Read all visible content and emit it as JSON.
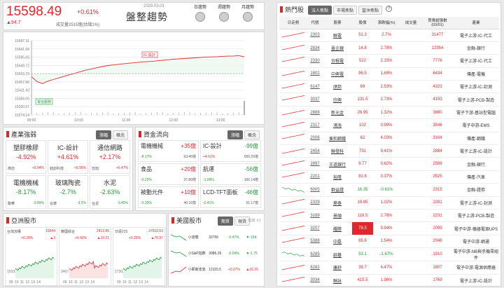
{
  "index": {
    "value": "15598.49",
    "pct": "+0.61%",
    "change": "▲94.7",
    "volume": "成交量2515億(估增1%)",
    "trend": "盤整趨勢",
    "periods": [
      "日趨勢",
      "週趨勢",
      "月趨勢"
    ],
    "date": "2029.03.01"
  },
  "intraday": {
    "yticks": [
      "15687.31",
      "15641.58",
      "15595.65",
      "15549.72",
      "15503.79",
      "15457.86",
      "15411.93",
      "15366.00",
      "15320.07",
      "15274.14"
    ],
    "xticks": [
      "09:00",
      "10:00",
      "11:00",
      "12:00",
      "13:00"
    ],
    "tag1": "IC-設計",
    "tag2": "電信服務",
    "chart_data": {
      "type": "line",
      "x_range": [
        "09:00",
        "13:30"
      ],
      "ylim": [
        15274.14,
        15687.31
      ],
      "series": [
        {
          "values": [
            15487,
            15460,
            15448,
            15462,
            15471,
            15480,
            15489,
            15498,
            15506,
            15515,
            15524,
            15530,
            15537,
            15543,
            15549,
            15552,
            15556,
            15559,
            15562,
            15565,
            15568,
            15570,
            15572,
            15575,
            15578,
            15581,
            15584,
            15586,
            15588,
            15590,
            15592,
            15594,
            15596,
            15597,
            15598,
            15600,
            15601,
            15602,
            15604,
            15598
          ]
        }
      ]
    }
  },
  "industry": {
    "title": "產業強弱",
    "tabs": [
      "漲幅",
      "概念"
    ],
    "cards": [
      {
        "name": "塑膠橡膠",
        "pct": "-4.92%",
        "sub1": "南亞",
        "sub1v": "+9.94%",
        "sub2": "",
        "sub2v": "",
        "col": "up"
      },
      {
        "name": "IC-設計",
        "pct": "+4.61%",
        "sub1": "鈺創科技",
        "sub1v": "+9.95%",
        "sub2": "",
        "sub2v": "",
        "col": "up"
      },
      {
        "name": "通信網路",
        "pct": "+2.17%",
        "sub1": "亞旭",
        "sub1v": "+6.47%",
        "sub2": "",
        "sub2v": "",
        "col": "up"
      },
      {
        "name": "電機機械",
        "pct": "-8.17%",
        "sub1": "聯華",
        "sub1v": "-9.89%",
        "sub2": "",
        "sub2v": "",
        "col": "dn"
      },
      {
        "name": "玻璃陶瓷",
        "pct": "-2.7%",
        "sub1": "台玻",
        "sub1v": "-3.2%",
        "sub2": "",
        "sub2v": "",
        "col": "dn"
      },
      {
        "name": "水泥",
        "pct": "-2.63%",
        "sub1": "台泥",
        "sub1v": "-3.45%",
        "sub2": "",
        "sub2v": "",
        "col": "dn"
      }
    ]
  },
  "flow": {
    "title": "資金流向",
    "tabs": [
      "漲幅",
      "概念"
    ],
    "cards": [
      {
        "name": "電機機械",
        "amt": "+35億",
        "pct": "-8.17%",
        "vol": "63.46億",
        "col": "up"
      },
      {
        "name": "IC-設計",
        "amt": "-99億",
        "pct": "+4.61%",
        "vol": "650.25億",
        "col": "dn"
      },
      {
        "name": "食品",
        "amt": "+20億",
        "pct": "-0.22%",
        "vol": "37.80億",
        "col": "up"
      },
      {
        "name": "航運",
        "amt": "-56億",
        "pct": "-1.09%",
        "vol": "166.14億",
        "col": "dn"
      },
      {
        "name": "被動元件",
        "amt": "+10億",
        "pct": "-0.33%",
        "vol": "40.16億",
        "col": "up"
      },
      {
        "name": "LCD-TFT面板",
        "amt": "-46億",
        "pct": "-0.41%",
        "vol": "51.17億",
        "col": "dn"
      }
    ]
  },
  "asia": {
    "title": "亞洲股市",
    "cards": [
      {
        "name": "台灣加權",
        "val": "15544",
        "pct": "+0.20%",
        "chg": "▲3",
        "lo": "15333",
        "x": "09 10 11 12 13 14"
      },
      {
        "name": "韓國綜合",
        "val": "2412.85",
        "pct": "+0.42%",
        "chg": "▲10.21",
        "lo": "2407",
        "x": "09 10 11 12 13 14"
      },
      {
        "name": "日經225",
        "val": "27510.53",
        "pct": "+0.26%",
        "chg": "▲70.97",
        "lo": "27303",
        "x": "09 10 11 12 13 14"
      }
    ]
  },
  "us": {
    "title": "美國股市",
    "tabs": [
      "期貨",
      "現貨"
    ],
    "note": "延遲 1/1",
    "rows": [
      {
        "name": "小道瓊",
        "val": "32755",
        "pct": "-0.47%",
        "chg": "▼-154"
      },
      {
        "name": "小S&P指數",
        "val": "3986.25",
        "pct": "-0.04%",
        "chg": "▼-1.75"
      },
      {
        "name": "小那斯達克",
        "val": "12115.5",
        "pct": "+0.27%",
        "chg": "▲32.25"
      }
    ]
  },
  "hot": {
    "title": "熱門股",
    "tabs": [
      "法人焦點",
      "市場焦點",
      "當沖焦點"
    ],
    "headers": [
      "日走勢",
      "代號",
      "股票",
      "股價",
      "漲跌幅(%)",
      "成交量",
      "買賣超張數(03/01)",
      "產業"
    ],
    "rows": [
      {
        "code": "2303",
        "name": "聯電",
        "price": "51.3",
        "pct": "2.7%",
        "vol": "31477",
        "ind": "電子上游-IC-代工",
        "c": "up"
      },
      {
        "code": "2834",
        "name": "臺企銀",
        "price": "14.8",
        "pct": "2.78%",
        "vol": "12954",
        "ind": "金融-銀行",
        "c": "up"
      },
      {
        "code": "2330",
        "name": "台積電",
        "price": "522",
        "pct": "2.15%",
        "vol": "7776",
        "ind": "電子上游-IC-代工",
        "c": "up"
      },
      {
        "code": "1802",
        "name": "中興電",
        "price": "96.5",
        "pct": "1.69%",
        "vol": "6434",
        "ind": "傳產-電機",
        "c": "up"
      },
      {
        "code": "6147",
        "name": "頎邦",
        "price": "69",
        "price2": "",
        "pct": "2.53%",
        "vol": "4323",
        "ind": "電子上游-IC-封測",
        "c": "up"
      },
      {
        "code": "3037",
        "name": "欣興",
        "price": "131.5",
        "pct": "2.73%",
        "vol": "4193",
        "ind": "電子上游-PCB-製造",
        "c": "up"
      },
      {
        "code": "2888",
        "name": "新光金",
        "price": "26.95",
        "pct": "1.32%",
        "vol": "3880",
        "ind": "電子下游-基站型電腦",
        "c": "up"
      },
      {
        "code": "2317",
        "name": "鴻海",
        "price": "102",
        "pct": "0.99%",
        "vol": "3546",
        "ind": "電子中游-EMS",
        "c": "up"
      },
      {
        "code": "2006",
        "name": "東和鋼鐵",
        "price": "62",
        "pct": "4.03%",
        "vol": "3164",
        "ind": "傳產-鋼鐵",
        "c": "up"
      },
      {
        "code": "2454",
        "name": "聯發科",
        "price": "791",
        "pct": "9.41%",
        "vol": "2884",
        "ind": "電子上游-IC-設計",
        "c": "up"
      },
      {
        "code": "2897",
        "name": "王道銀行",
        "price": "9.77",
        "pct": "0.62%",
        "vol": "2589",
        "ind": "金融-銀行",
        "c": "up"
      },
      {
        "code": "2201",
        "name": "裕隆",
        "price": "81.6",
        "pct": "0.37%",
        "vol": "2525",
        "ind": "傳產-汽車",
        "c": "up"
      },
      {
        "code": "6005",
        "name": "群益證",
        "price": "16.35",
        "pct": "-0.61%",
        "vol": "2315",
        "ind": "金融-證券",
        "c": "dn"
      },
      {
        "code": "2329",
        "name": "華泰",
        "price": "19.85",
        "pct": "1.02%",
        "vol": "2281",
        "ind": "電子上游-IC-封測",
        "c": "up"
      },
      {
        "code": "3189",
        "name": "景碩",
        "price": "118.5",
        "pct": "2.76%",
        "vol": "2231",
        "ind": "電子上游-PCB-製造",
        "c": "up"
      },
      {
        "code": "3207",
        "name": "耀勝",
        "price": "78.5",
        "pct": "9.94%",
        "vol": "2099",
        "ind": "電子中游-儀器電源UPS",
        "c": "up",
        "hl": true
      },
      {
        "code": "5388",
        "name": "中磊",
        "price": "85.6",
        "pct": "1.54%",
        "vol": "2048",
        "ind": "電子中游-網通",
        "c": "up"
      },
      {
        "code": "6285",
        "name": "啟碁",
        "price": "53.1",
        "pct": "-1.67%",
        "vol": "1910",
        "ind": "電子中游-NB與手機零組件",
        "c": "dn"
      },
      {
        "code": "6282",
        "name": "康舒",
        "price": "39.7",
        "pct": "4.47%",
        "vol": "1807",
        "ind": "電子中游-電源供應器",
        "c": "up"
      },
      {
        "code": "3034",
        "name": "聯詠",
        "price": "415.5",
        "pct": "1.96%",
        "vol": "1769",
        "ind": "電子上游-IC-設計",
        "c": "up"
      }
    ]
  },
  "colors": {
    "up": "#e3262b",
    "down": "#1f9a3a",
    "accent": "#d02b2b"
  }
}
